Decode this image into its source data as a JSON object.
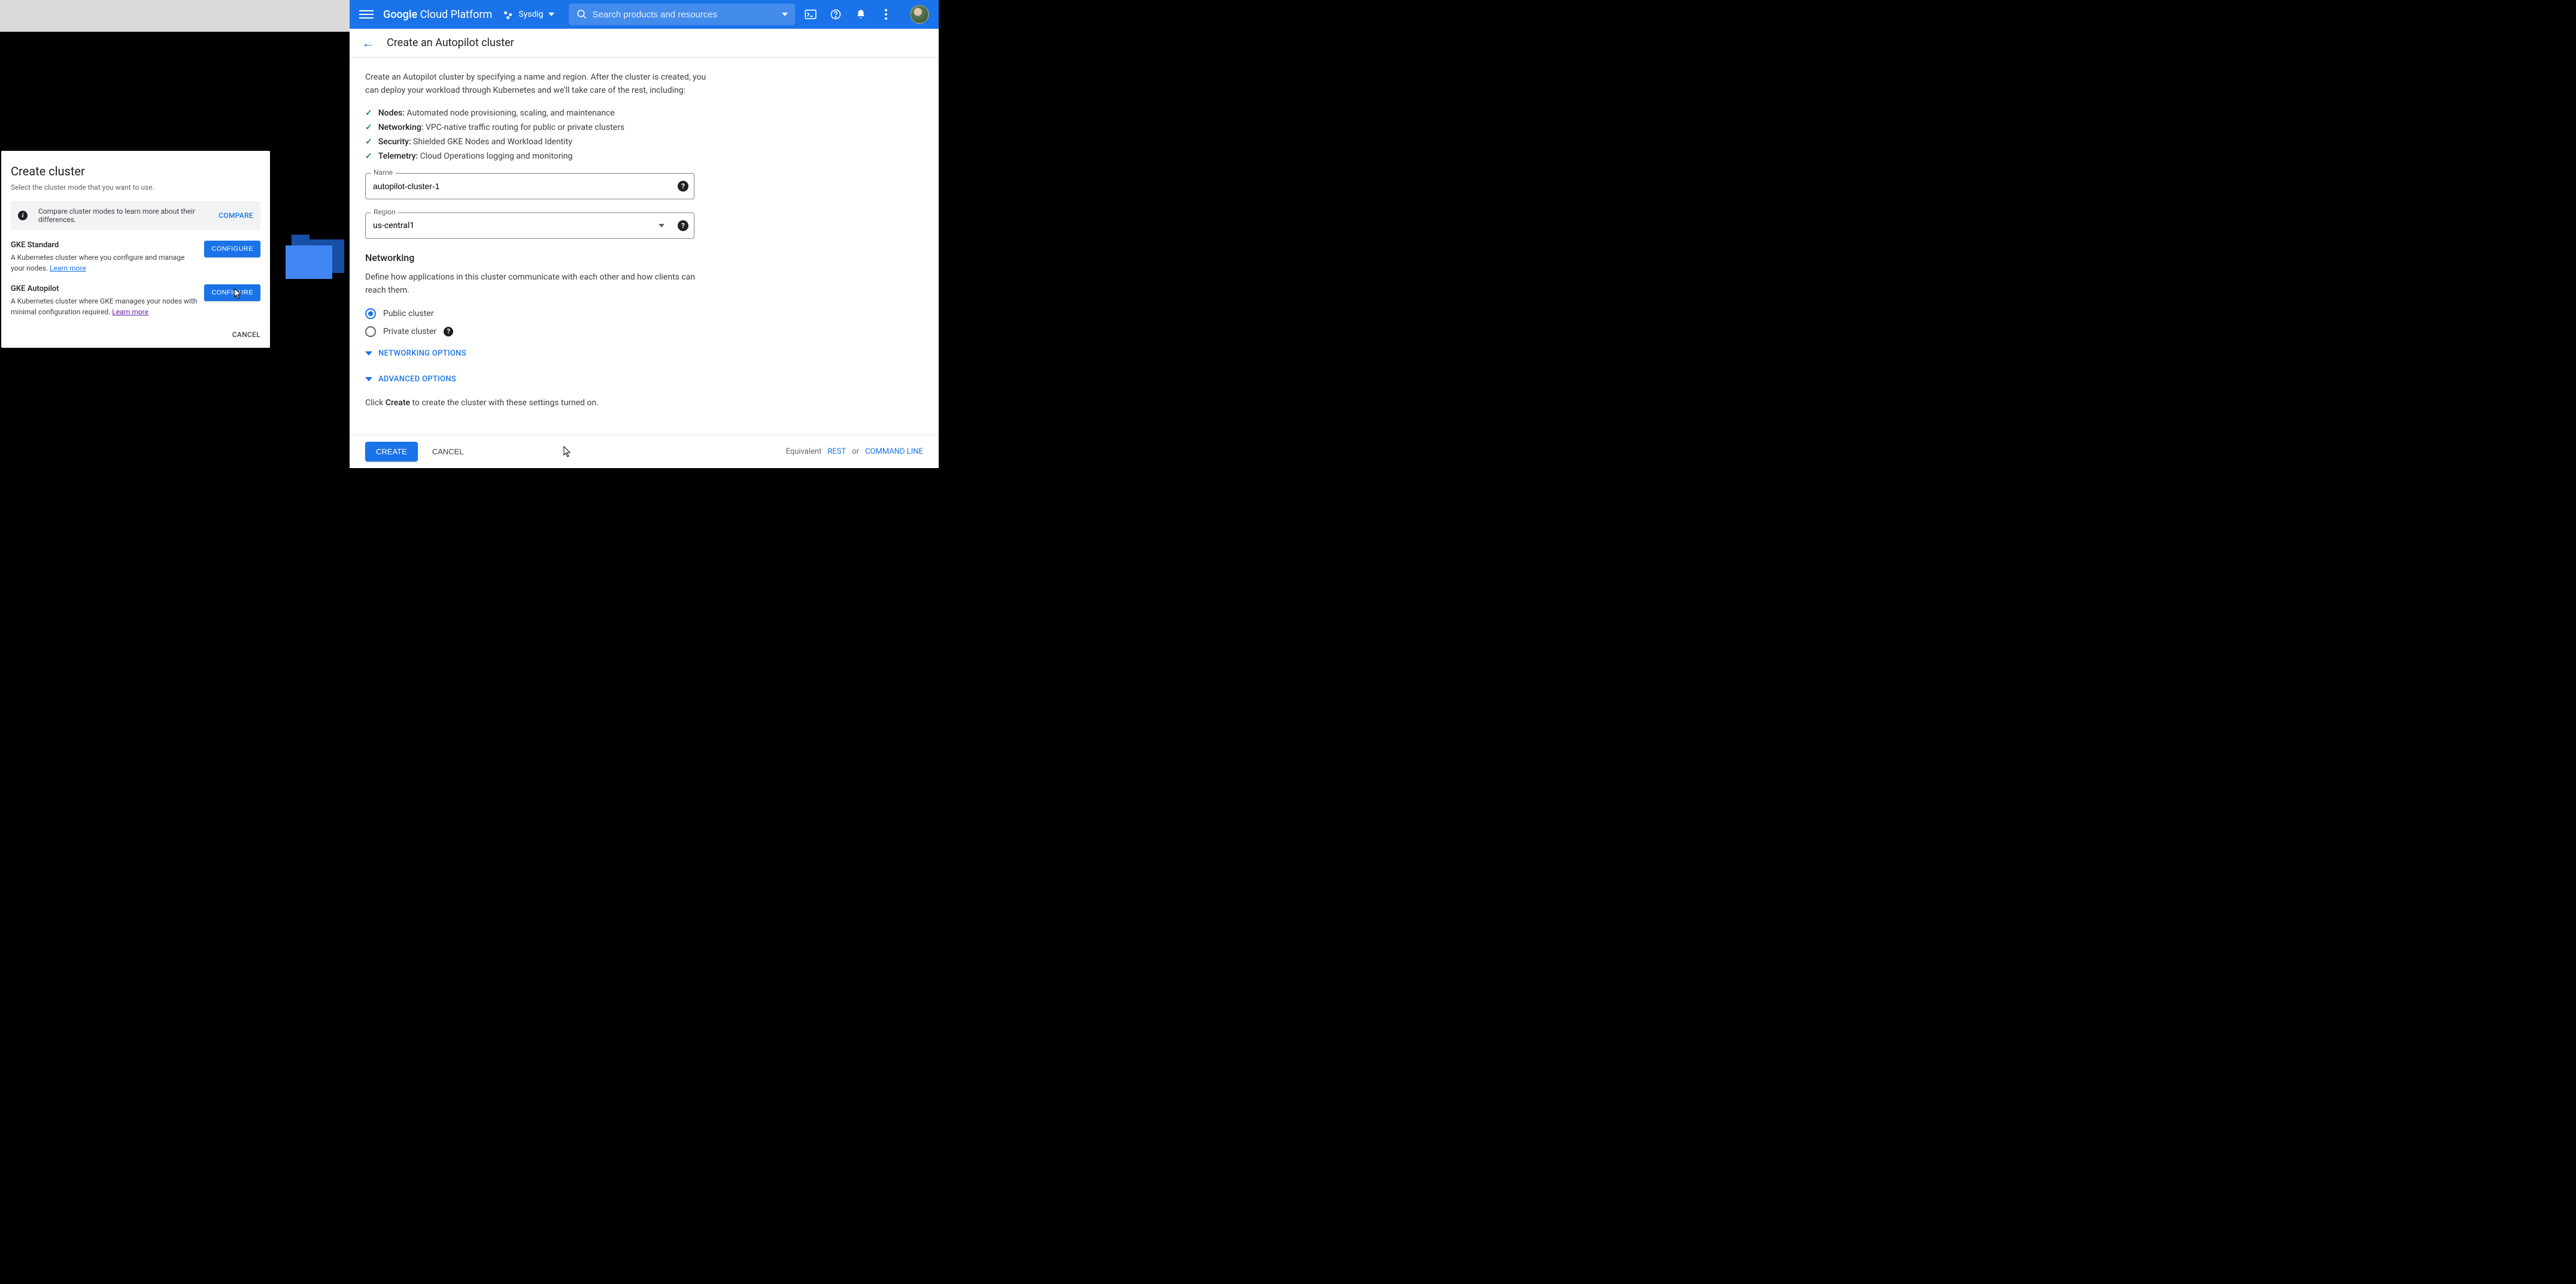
{
  "dialog": {
    "title": "Create cluster",
    "subtitle": "Select the cluster mode that you want to use.",
    "compare_msg": "Compare cluster modes to learn more about their differences.",
    "compare_link": "COMPARE",
    "standard": {
      "title": "GKE Standard",
      "desc": "A Kubernetes cluster where you configure and manage your nodes.",
      "learn": "Learn more",
      "btn": "CONFIGURE"
    },
    "autopilot": {
      "title": "GKE Autopilot",
      "desc": "A Kubernetes cluster where GKE manages your nodes with minimal configuration required.",
      "learn": "Learn more",
      "btn": "CONFIGURE"
    },
    "cancel": "CANCEL"
  },
  "topbar": {
    "brand": "Google Cloud Platform",
    "project": "Sysdig",
    "search_placeholder": "Search products and resources"
  },
  "page": {
    "title": "Create an Autopilot cluster",
    "intro": "Create an Autopilot cluster by specifying a name and region. After the cluster is created, you can deploy your workload through Kubernetes and we'll take care of the rest, including:",
    "features": [
      {
        "label": "Nodes:",
        "text": "Automated node provisioning, scaling, and maintenance"
      },
      {
        "label": "Networking:",
        "text": "VPC-native traffic routing for public or private clusters"
      },
      {
        "label": "Security:",
        "text": "Shielded GKE Nodes and Workload Identity"
      },
      {
        "label": "Telemetry:",
        "text": "Cloud Operations logging and monitoring"
      }
    ],
    "name_label": "Name",
    "name_value": "autopilot-cluster-1",
    "region_label": "Region",
    "region_value": "us-central1",
    "networking_h": "Networking",
    "networking_p": "Define how applications in this cluster communicate with each other and how clients can reach them.",
    "radio_public": "Public cluster",
    "radio_private": "Private cluster",
    "exp_net": "NETWORKING OPTIONS",
    "exp_adv": "ADVANCED OPTIONS",
    "footnote_pre": "Click ",
    "footnote_b": "Create",
    "footnote_post": " to create the cluster with these settings turned on."
  },
  "bottombar": {
    "create": "CREATE",
    "cancel": "CANCEL",
    "equiv": "Equivalent",
    "rest": "REST",
    "or": "or",
    "cli": "COMMAND LINE"
  }
}
